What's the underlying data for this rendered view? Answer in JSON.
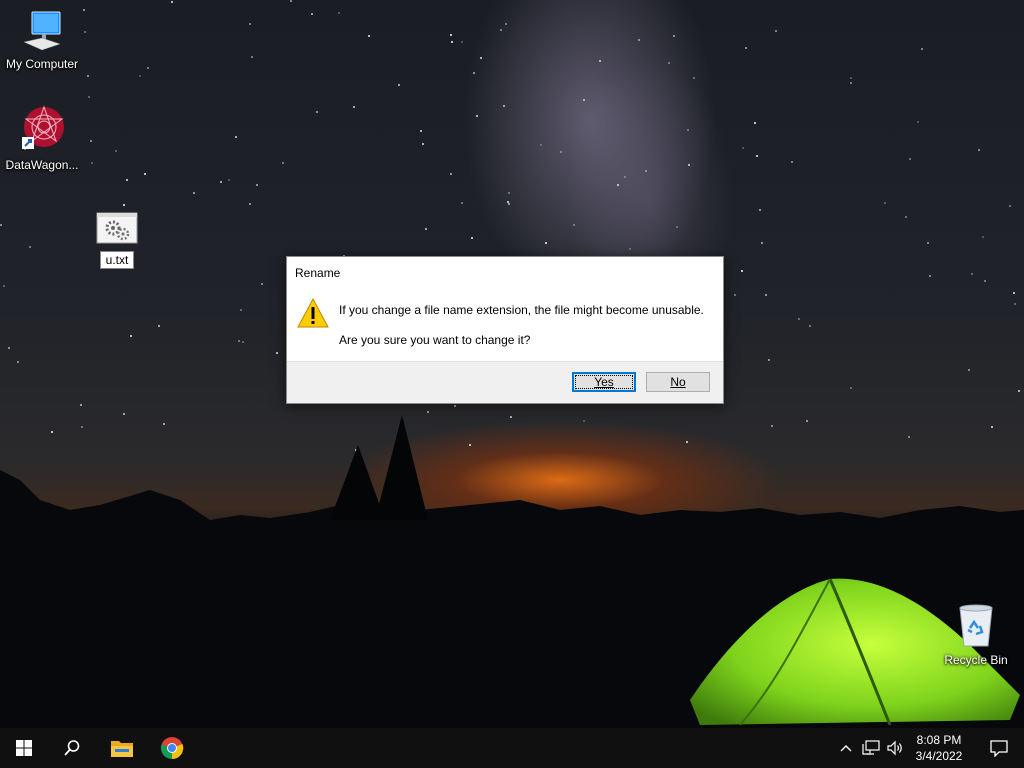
{
  "desktop": {
    "icons": [
      {
        "label": "My Computer"
      },
      {
        "label": "DataWagon..."
      },
      {
        "label": "u.txt"
      },
      {
        "label": "Recycle Bin"
      }
    ]
  },
  "dialog": {
    "title": "Rename",
    "message": "If you change a file name extension, the file might become unusable.",
    "question": "Are you sure you want to change it?",
    "icon": "warning-icon",
    "yes_label": "Yes",
    "no_label": "No"
  },
  "taskbar": {
    "apps": [
      "start-icon",
      "search-icon",
      "file-explorer-icon",
      "chrome-icon"
    ],
    "clock": {
      "time": "8:08 PM",
      "date": "3/4/2022"
    }
  },
  "colors": {
    "accent": "#0078d7",
    "taskbar": "#101010",
    "dialog_footer": "#f0f0f0"
  }
}
